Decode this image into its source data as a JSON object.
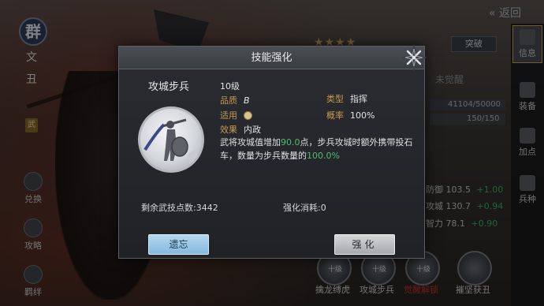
{
  "background": {
    "faction_badge": "群",
    "hero_name_chars": [
      "文",
      "丑"
    ],
    "rank_chip": "武",
    "left_buttons": [
      {
        "label": "兑换",
        "icon": "exchange-icon"
      },
      {
        "label": "攻略",
        "icon": "guide-icon"
      },
      {
        "label": "羁绊",
        "icon": "bond-icon"
      }
    ],
    "back_label": "返回",
    "stars": "★★★★",
    "breakthrough_label": "突破",
    "right_tabs": [
      {
        "label": "信息",
        "icon": "info-icon",
        "active": true
      },
      {
        "label": "装备",
        "icon": "equipment-icon",
        "active": false
      },
      {
        "label": "加点",
        "icon": "points-icon",
        "active": false
      },
      {
        "label": "兵种",
        "icon": "troop-icon",
        "active": false
      }
    ],
    "unawakened_label": "未觉醒",
    "exp_text": "41104/50000",
    "troop_text": "150/150",
    "stats": [
      {
        "label": "防御",
        "value": "103.5",
        "bonus": "+1.00"
      },
      {
        "label": "攻城",
        "value": "130.7",
        "bonus": "+0.94"
      },
      {
        "label": "智力",
        "value": "78.1",
        "bonus": "+0.90"
      }
    ],
    "bottom_skills": [
      {
        "name": "擒龙缚虎",
        "red": false
      },
      {
        "name": "攻城步兵",
        "red": false
      },
      {
        "name": "觉醒解锁",
        "red": true
      },
      {
        "name": "摧坚获丑",
        "red": false
      }
    ],
    "bottom_skill_badges": [
      "十级",
      "十级",
      "十级"
    ]
  },
  "dialog": {
    "title": "技能强化",
    "skill_name": "攻城步兵",
    "level": "10级",
    "quality_label": "品质",
    "quality_value": "B",
    "type_label": "类型",
    "type_value": "指挥",
    "apply_label": "适用",
    "apply_icon": "weapon-type-icon",
    "rate_label": "概率",
    "rate_value": "100%",
    "effect_label": "效果",
    "effect_value": "内政",
    "description": {
      "part1": "武将攻城值增加",
      "num1": "90.0",
      "part2": "点，步兵攻城时额外携带投石车，数量为步兵数量的",
      "num2": "100.0%"
    },
    "remaining_points_label": "剩余武技点数:",
    "remaining_points_value": "3442",
    "cost_label": "强化消耗:",
    "cost_value": "0",
    "forget_button": "遗忘",
    "enhance_button": "强化"
  }
}
